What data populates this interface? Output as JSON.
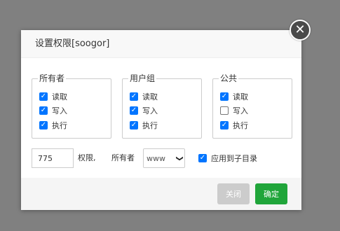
{
  "dialog": {
    "title": "设置权限[soogor]"
  },
  "groups": [
    {
      "label": "所有者",
      "perms": [
        {
          "label": "读取",
          "checked": true
        },
        {
          "label": "写入",
          "checked": true
        },
        {
          "label": "执行",
          "checked": true
        }
      ]
    },
    {
      "label": "用户组",
      "perms": [
        {
          "label": "读取",
          "checked": true
        },
        {
          "label": "写入",
          "checked": true
        },
        {
          "label": "执行",
          "checked": true
        }
      ]
    },
    {
      "label": "公共",
      "perms": [
        {
          "label": "读取",
          "checked": true
        },
        {
          "label": "写入",
          "checked": false
        },
        {
          "label": "执行",
          "checked": true
        }
      ]
    }
  ],
  "permission": {
    "value": "775",
    "label": "权限,"
  },
  "owner": {
    "label": "所有者",
    "selected": "www"
  },
  "apply_subdirs": {
    "label": "应用到子目录",
    "checked": true
  },
  "footer": {
    "close_label": "关闭",
    "ok_label": "确定"
  },
  "colors": {
    "overlay": "#808080",
    "confirm": "#20a53a",
    "close_button": "#cccccc",
    "checkbox": "#0075ff"
  }
}
